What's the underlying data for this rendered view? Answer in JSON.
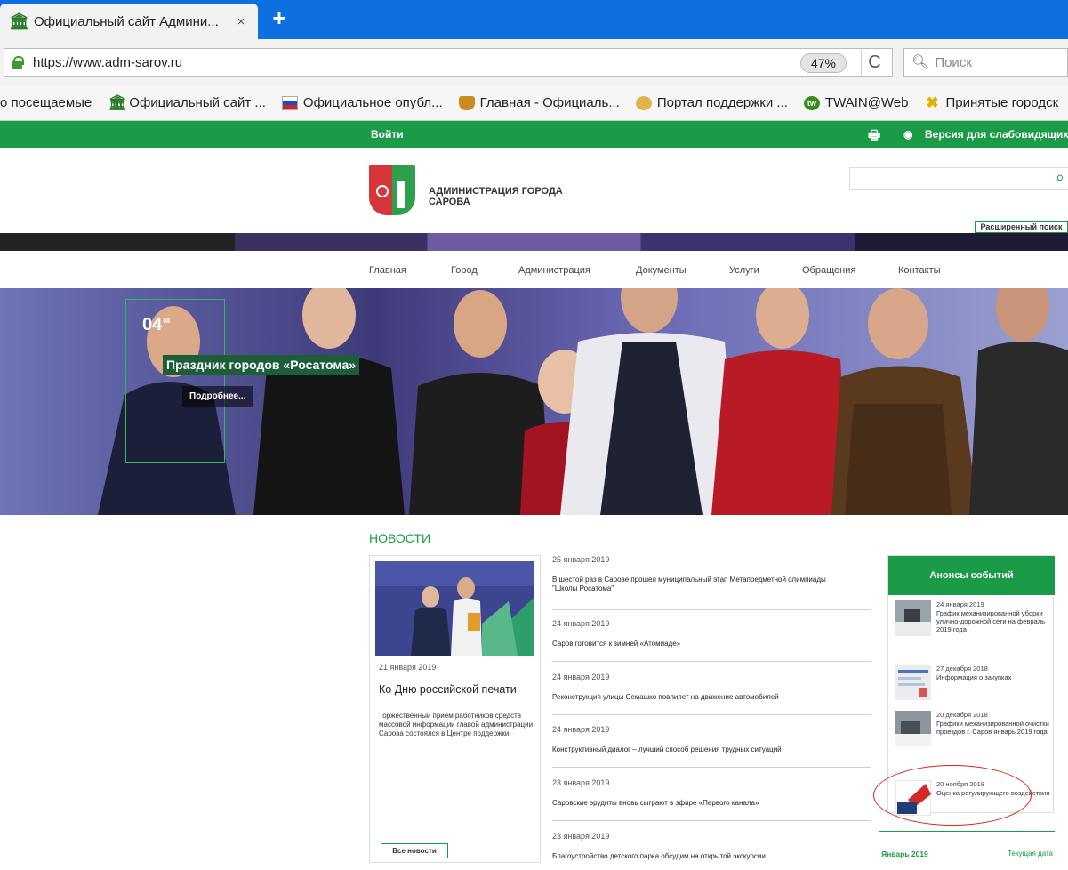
{
  "browser": {
    "tab_title": "Официальный сайт Админи...",
    "tab_close": "×",
    "new_tab": "+",
    "url": "https://www.adm-sarov.ru",
    "zoom": "47%",
    "reload": "C",
    "search_placeholder": "Поиск",
    "bookmarks": [
      {
        "label": "о посещаемые",
        "icon": ""
      },
      {
        "label": "Официальный сайт ...",
        "icon": "museum-icon"
      },
      {
        "label": "Официальное опубл...",
        "icon": "flag-icon"
      },
      {
        "label": "Главная - Официаль...",
        "icon": "shield-icon"
      },
      {
        "label": "Портал поддержки ...",
        "icon": "portal-icon"
      },
      {
        "label": "TWAIN@Web",
        "icon": "tw-icon",
        "icon_text": "tw"
      },
      {
        "label": "Принятые городск",
        "icon": "x-icon"
      }
    ]
  },
  "site": {
    "topstrip": {
      "login": "Войти",
      "low_vision": "Версия для слабовидящих"
    },
    "header": {
      "site_name": "АДМИНИСТРАЦИЯ ГОРОДА САРОВА",
      "advanced_search": "Расширенный поиск"
    },
    "nav": [
      "Главная",
      "Город",
      "Администрация",
      "Документы",
      "Услуги",
      "Обращения",
      "Контакты"
    ],
    "slide": {
      "date_day": "04",
      "date_sup": "08",
      "title": "Праздник городов «Росатома»",
      "more": "Подробнее..."
    },
    "news": {
      "section_title": "НОВОСТИ",
      "lead": {
        "date": "21 января 2019",
        "title": "Ко Дню российской печати",
        "text": "Торжественный прием работников средств массовой информации главой администрации Сарова состоялся в Центре поддержки"
      },
      "all_news": "Все новости",
      "items": [
        {
          "date": "25 января 2019",
          "title": "В шестой раз в Сарове прошел муниципальный этап Метапредметной олимпиады \"Школы Росатома\""
        },
        {
          "date": "24 января 2019",
          "title": "Саров готовится к зимней «Атомиаде»"
        },
        {
          "date": "24 января 2019",
          "title": "Реконструкция улицы Семашко повлияет на движение автомобилей"
        },
        {
          "date": "24 января 2019",
          "title": "Конструктивный диалог – лучший способ решения трудных ситуаций"
        },
        {
          "date": "23 января 2019",
          "title": "Саровские эрудиты вновь сыграют в эфире «Первого канала»"
        },
        {
          "date": "23 января 2019",
          "title": "Благоустройство детского парка обсудим на открытой экскурсии"
        }
      ]
    },
    "announcements": {
      "title": "Анонсы событий",
      "items": [
        {
          "date": "24 января 2019",
          "title": "График механизированной уборки улично-дорожной сети на февраль 2019 года"
        },
        {
          "date": "27 декабря 2018",
          "title": "Информация о закупках"
        },
        {
          "date": "20 декабря 2018",
          "title": "Графики механизированной очистки проездов г. Саров январь 2019 года."
        },
        {
          "date": "20 ноября 2018",
          "title": "Оценка регулирующего воздействия"
        }
      ]
    },
    "calendar": {
      "month": "Январь 2019",
      "today": "Текущая дата"
    }
  },
  "colors": {
    "brand_green": "#1a9b48",
    "browser_blue": "#0e6fe0"
  }
}
